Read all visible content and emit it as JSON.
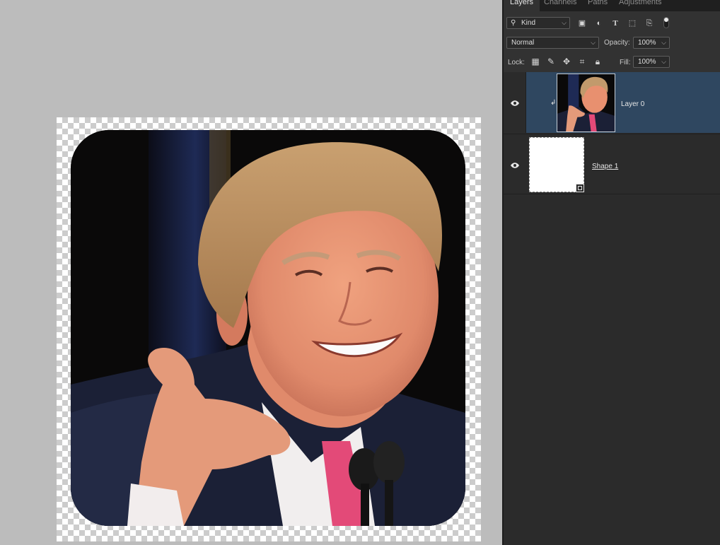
{
  "panel_tabs": [
    "Layers",
    "Channels",
    "Paths",
    "Adjustments"
  ],
  "filter": {
    "kind_label": "Kind",
    "icons": [
      "image-filter-icon",
      "adjustment-filter-icon",
      "type-filter-icon",
      "shape-filter-icon",
      "smart-object-filter-icon"
    ]
  },
  "blend": {
    "mode": "Normal",
    "opacity_label": "Opacity:",
    "opacity_value": "100%"
  },
  "lock": {
    "label": "Lock:",
    "fill_label": "Fill:",
    "fill_value": "100%",
    "icons": [
      "lock-transparent-icon",
      "lock-image-icon",
      "lock-position-icon",
      "lock-artboard-icon",
      "lock-all-icon"
    ]
  },
  "layers": [
    {
      "name": "Layer 0",
      "visible": true,
      "selected": true,
      "clipped": true
    },
    {
      "name": "Shape 1",
      "visible": true,
      "selected": false,
      "shape": true
    }
  ],
  "colors": {
    "selected_layer": "#2f4760",
    "panel_bg": "#2b2b2b",
    "canvas_bg": "#bcbcbc"
  }
}
